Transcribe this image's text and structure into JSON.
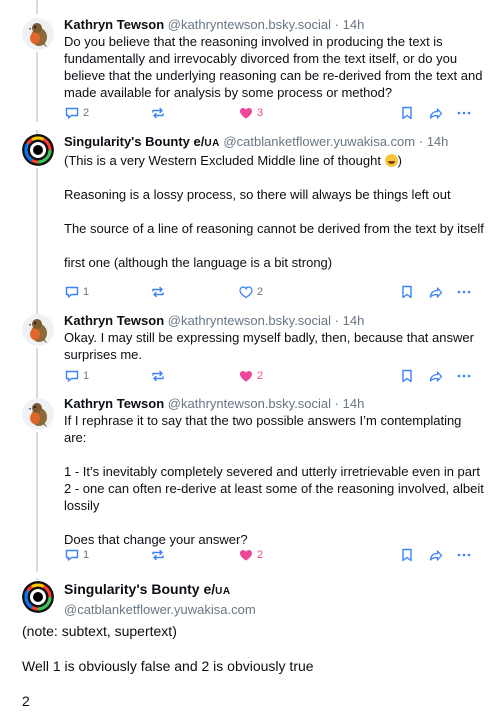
{
  "posts": [
    {
      "author": "Kathryn Tewson",
      "handle": "@kathryntewson.bsky.social",
      "time": "14h",
      "body": [
        "Do you believe that the reasoning involved in producing the text is fundamentally and irrevocably divorced from the text itself, or do you believe that the underlying reasoning can be re-derived from the text and made available for analysis by some process or method?"
      ],
      "replies": "2",
      "likes": "3",
      "liked": true
    },
    {
      "author": "Singularity's Bounty e/",
      "author_suffix": "UA",
      "handle": "@catblanketflower.yuwakisa.com",
      "time": "14h",
      "body_first": "(This is a very Western Excluded Middle line of thought",
      "body_first_end": ")",
      "body": [
        "",
        "Reasoning is a lossy process, so there will always be things left out",
        "",
        "The source of a line of reasoning cannot be derived from the text by itself",
        "",
        "first one (although the language is a bit strong)"
      ],
      "replies": "1",
      "likes": "2",
      "liked": false
    },
    {
      "author": "Kathryn Tewson",
      "handle": "@kathryntewson.bsky.social",
      "time": "14h",
      "body": [
        "Okay. I may still be expressing myself badly, then, because that answer surprises me."
      ],
      "replies": "1",
      "likes": "2",
      "liked": true
    },
    {
      "author": "Kathryn Tewson",
      "handle": "@kathryntewson.bsky.social",
      "time": "14h",
      "body": [
        "If I rephrase it to say that the two possible answers I’m contemplating are:",
        "",
        "1 - It’s inevitably completely severed and utterly irretrievable even in part",
        "2 - one can often re-derive at least some of the reasoning involved, albeit lossily",
        "",
        "Does that change your answer?"
      ],
      "replies": "1",
      "likes": "2",
      "liked": true
    }
  ],
  "focus": {
    "author": "Singularity's Bounty e/",
    "author_suffix": "UA",
    "handle": "@catblanketflower.yuwakisa.com",
    "body": [
      "(note: subtext, supertext)",
      "",
      "Well 1 is obviously false and 2 is obviously true",
      "",
      "2"
    ]
  },
  "separator": "·",
  "colors": {
    "like": "#ec4899",
    "muted": "#687684",
    "thread_line": "#d4dbe2"
  },
  "icons": [
    "reply-icon",
    "repost-icon",
    "heart-icon",
    "bookmark-icon",
    "share-icon",
    "more-icon"
  ]
}
